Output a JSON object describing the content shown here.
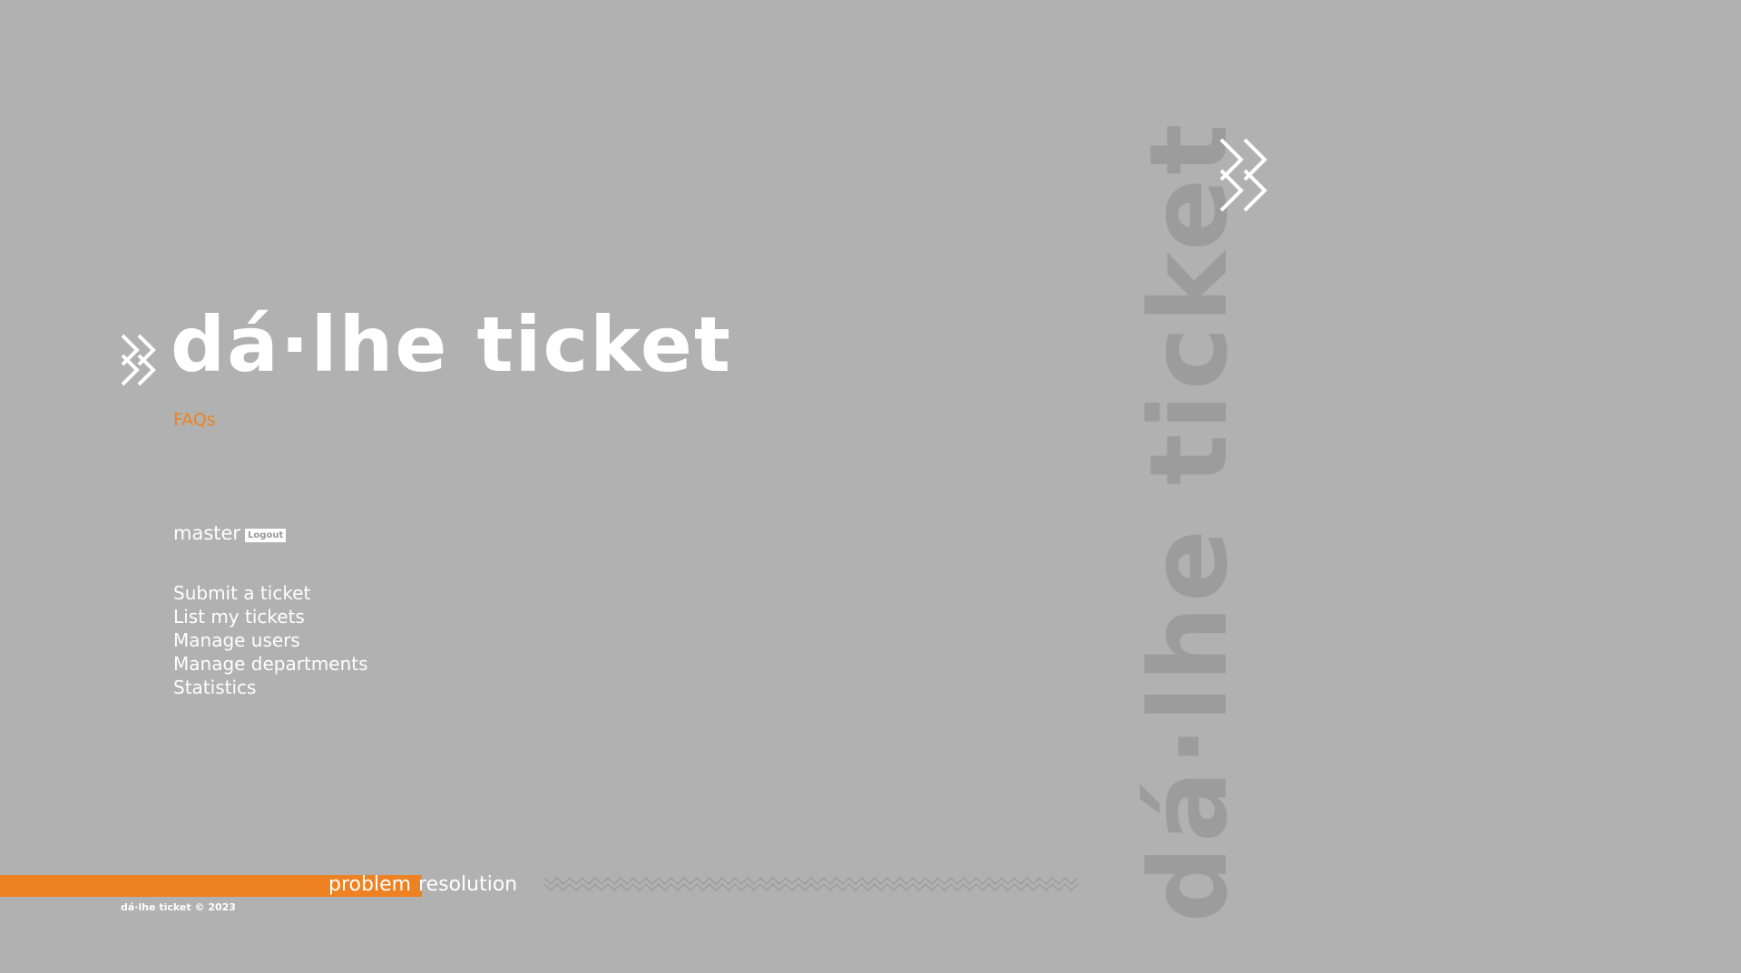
{
  "brand": {
    "title": "dá·lhe ticket",
    "chevrons_icon": "double-chevron-right-icon"
  },
  "nav_top": {
    "faq_label": "FAQs"
  },
  "user": {
    "username": "master",
    "logout_label": "Logout"
  },
  "main_nav": {
    "items": [
      {
        "label": "Submit a ticket"
      },
      {
        "label": "List my tickets"
      },
      {
        "label": "Manage users"
      },
      {
        "label": "Manage departments"
      },
      {
        "label": "Statistics"
      }
    ]
  },
  "footer": {
    "tagline_highlight": "problem",
    "tagline_rest": "resolution",
    "copyright": "dá·lhe ticket © 2023"
  },
  "watermark": {
    "vertical_text": "dá·lhe ticket"
  },
  "colors": {
    "background": "#b0b1b0",
    "accent": "#ee8222",
    "watermark": "#9c9c9c",
    "text": "#ffffff"
  }
}
